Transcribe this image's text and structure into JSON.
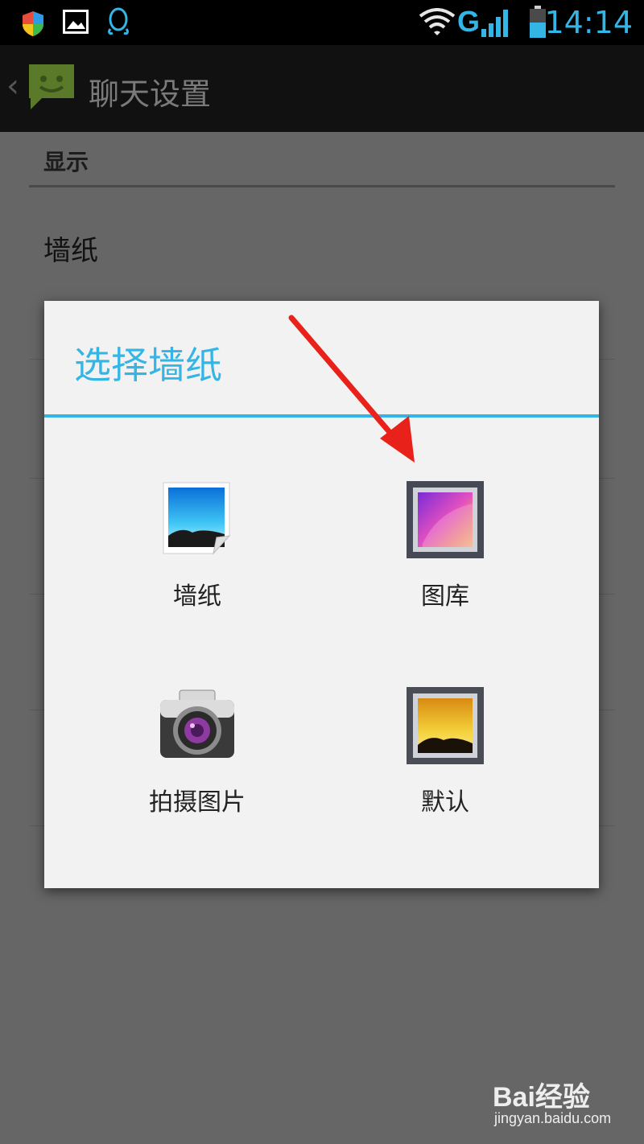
{
  "status_bar": {
    "network_type": "G",
    "time": "14:14",
    "icons": [
      "shield-icon",
      "image-notification-icon",
      "qq-icon",
      "wifi-icon",
      "signal-icon",
      "battery-icon"
    ]
  },
  "action_bar": {
    "back_glyph": "‹",
    "title": "聊天设置"
  },
  "settings": {
    "section_header": "显示",
    "wallpaper_item": "墙纸"
  },
  "dialog": {
    "title": "选择墙纸",
    "options": [
      {
        "label": "墙纸",
        "icon": "wallpaper-icon"
      },
      {
        "label": "图库",
        "icon": "gallery-icon"
      },
      {
        "label": "拍摄图片",
        "icon": "camera-icon"
      },
      {
        "label": "默认",
        "icon": "default-wallpaper-icon"
      }
    ]
  },
  "annotation": {
    "icon": "red-arrow-icon",
    "color": "#e8221b"
  },
  "watermark": {
    "brand": "Bai经验",
    "url": "jingyan.baidu.com"
  },
  "colors": {
    "accent": "#33b5e5",
    "dim_background": "#666666",
    "dialog_background": "#f2f2f2"
  }
}
